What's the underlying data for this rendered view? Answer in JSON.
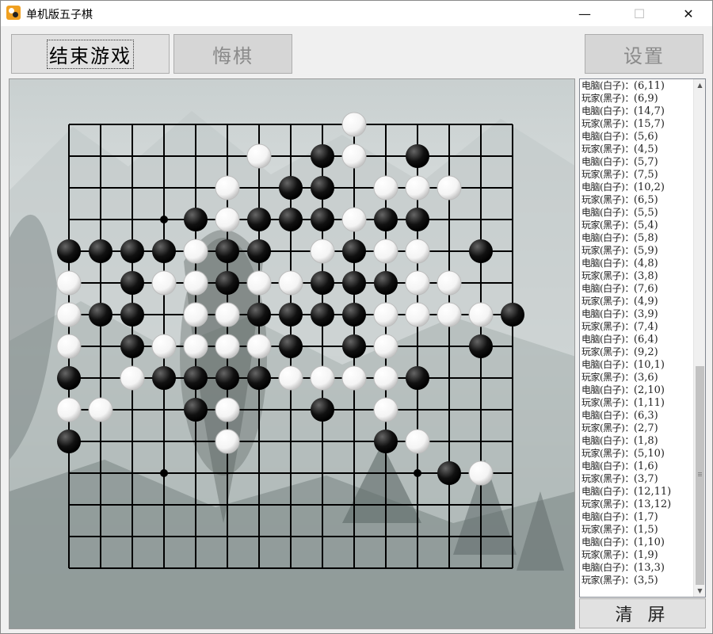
{
  "window": {
    "title": "单机版五子棋",
    "minimize_glyph": "—",
    "maximize_glyph": "☐",
    "close_glyph": "✕"
  },
  "toolbar": {
    "end_game_label": "结束游戏",
    "undo_label": "悔棋",
    "settings_label": "设置"
  },
  "panel": {
    "clear_label": "清 屏",
    "scroll_up_glyph": "▲",
    "scroll_down_glyph": "▼"
  },
  "colors": {
    "black_stone": "#111111",
    "white_stone": "#f4f4f4",
    "grid": "#000000"
  },
  "board": {
    "size": 15,
    "star_points": [
      [
        3,
        3
      ],
      [
        11,
        3
      ],
      [
        3,
        11
      ],
      [
        11,
        11
      ]
    ],
    "black_stones": [
      [
        8,
        1
      ],
      [
        11,
        1
      ],
      [
        7,
        2
      ],
      [
        8,
        2
      ],
      [
        4,
        3
      ],
      [
        6,
        3
      ],
      [
        7,
        3
      ],
      [
        8,
        3
      ],
      [
        10,
        3
      ],
      [
        11,
        3
      ],
      [
        0,
        4
      ],
      [
        1,
        4
      ],
      [
        2,
        4
      ],
      [
        3,
        4
      ],
      [
        5,
        4
      ],
      [
        6,
        4
      ],
      [
        9,
        4
      ],
      [
        13,
        4
      ],
      [
        2,
        5
      ],
      [
        5,
        5
      ],
      [
        8,
        5
      ],
      [
        9,
        5
      ],
      [
        10,
        5
      ],
      [
        1,
        6
      ],
      [
        2,
        6
      ],
      [
        6,
        6
      ],
      [
        7,
        6
      ],
      [
        8,
        6
      ],
      [
        9,
        6
      ],
      [
        14,
        6
      ],
      [
        2,
        7
      ],
      [
        7,
        7
      ],
      [
        9,
        7
      ],
      [
        13,
        7
      ],
      [
        0,
        8
      ],
      [
        3,
        8
      ],
      [
        4,
        8
      ],
      [
        5,
        8
      ],
      [
        6,
        8
      ],
      [
        11,
        8
      ],
      [
        4,
        9
      ],
      [
        8,
        9
      ],
      [
        0,
        10
      ],
      [
        10,
        10
      ],
      [
        12,
        11
      ]
    ],
    "white_stones": [
      [
        9,
        0
      ],
      [
        6,
        1
      ],
      [
        9,
        1
      ],
      [
        5,
        2
      ],
      [
        10,
        2
      ],
      [
        11,
        2
      ],
      [
        12,
        2
      ],
      [
        5,
        3
      ],
      [
        9,
        3
      ],
      [
        4,
        4
      ],
      [
        8,
        4
      ],
      [
        10,
        4
      ],
      [
        11,
        4
      ],
      [
        0,
        5
      ],
      [
        3,
        5
      ],
      [
        4,
        5
      ],
      [
        6,
        5
      ],
      [
        7,
        5
      ],
      [
        11,
        5
      ],
      [
        12,
        5
      ],
      [
        0,
        6
      ],
      [
        4,
        6
      ],
      [
        5,
        6
      ],
      [
        10,
        6
      ],
      [
        11,
        6
      ],
      [
        12,
        6
      ],
      [
        13,
        6
      ],
      [
        0,
        7
      ],
      [
        3,
        7
      ],
      [
        4,
        7
      ],
      [
        5,
        7
      ],
      [
        6,
        7
      ],
      [
        10,
        7
      ],
      [
        2,
        8
      ],
      [
        7,
        8
      ],
      [
        8,
        8
      ],
      [
        9,
        8
      ],
      [
        10,
        8
      ],
      [
        0,
        9
      ],
      [
        1,
        9
      ],
      [
        5,
        9
      ],
      [
        10,
        9
      ],
      [
        5,
        10
      ],
      [
        11,
        10
      ],
      [
        13,
        11
      ]
    ]
  },
  "moves": [
    {
      "player": "电脑(白子)：",
      "pos": "(6,11)"
    },
    {
      "player": "玩家(黑子)：",
      "pos": "(6,9)"
    },
    {
      "player": "电脑(白子)：",
      "pos": "(14,7)"
    },
    {
      "player": "玩家(黑子)：",
      "pos": "(15,7)"
    },
    {
      "player": "电脑(白子)：",
      "pos": "(5,6)"
    },
    {
      "player": "玩家(黑子)：",
      "pos": "(4,5)"
    },
    {
      "player": "电脑(白子)：",
      "pos": "(5,7)"
    },
    {
      "player": "玩家(黑子)：",
      "pos": "(7,5)"
    },
    {
      "player": "电脑(白子)：",
      "pos": "(10,2)"
    },
    {
      "player": "玩家(黑子)：",
      "pos": "(6,5)"
    },
    {
      "player": "电脑(白子)：",
      "pos": "(5,5)"
    },
    {
      "player": "玩家(黑子)：",
      "pos": "(5,4)"
    },
    {
      "player": "电脑(白子)：",
      "pos": "(5,8)"
    },
    {
      "player": "玩家(黑子)：",
      "pos": "(5,9)"
    },
    {
      "player": "电脑(白子)：",
      "pos": "(4,8)"
    },
    {
      "player": "玩家(黑子)：",
      "pos": "(3,8)"
    },
    {
      "player": "电脑(白子)：",
      "pos": "(7,6)"
    },
    {
      "player": "玩家(黑子)：",
      "pos": "(4,9)"
    },
    {
      "player": "电脑(白子)：",
      "pos": "(3,9)"
    },
    {
      "player": "玩家(黑子)：",
      "pos": "(7,4)"
    },
    {
      "player": "电脑(白子)：",
      "pos": "(6,4)"
    },
    {
      "player": "玩家(黑子)：",
      "pos": "(9,2)"
    },
    {
      "player": "电脑(白子)：",
      "pos": "(10,1)"
    },
    {
      "player": "玩家(黑子)：",
      "pos": "(3,6)"
    },
    {
      "player": "电脑(白子)：",
      "pos": "(2,10)"
    },
    {
      "player": "玩家(黑子)：",
      "pos": "(1,11)"
    },
    {
      "player": "电脑(白子)：",
      "pos": "(6,3)"
    },
    {
      "player": "玩家(黑子)：",
      "pos": "(2,7)"
    },
    {
      "player": "电脑(白子)：",
      "pos": "(1,8)"
    },
    {
      "player": "玩家(黑子)：",
      "pos": "(5,10)"
    },
    {
      "player": "电脑(白子)：",
      "pos": "(1,6)"
    },
    {
      "player": "玩家(黑子)：",
      "pos": "(3,7)"
    },
    {
      "player": "电脑(白子)：",
      "pos": "(12,11)"
    },
    {
      "player": "玩家(黑子)：",
      "pos": "(13,12)"
    },
    {
      "player": "电脑(白子)：",
      "pos": "(1,7)"
    },
    {
      "player": "玩家(黑子)：",
      "pos": "(1,5)"
    },
    {
      "player": "电脑(白子)：",
      "pos": "(1,10)"
    },
    {
      "player": "玩家(黑子)：",
      "pos": "(1,9)"
    },
    {
      "player": "电脑(白子)：",
      "pos": "(13,3)"
    },
    {
      "player": "玩家(黑子)：",
      "pos": "(3,5)"
    }
  ]
}
